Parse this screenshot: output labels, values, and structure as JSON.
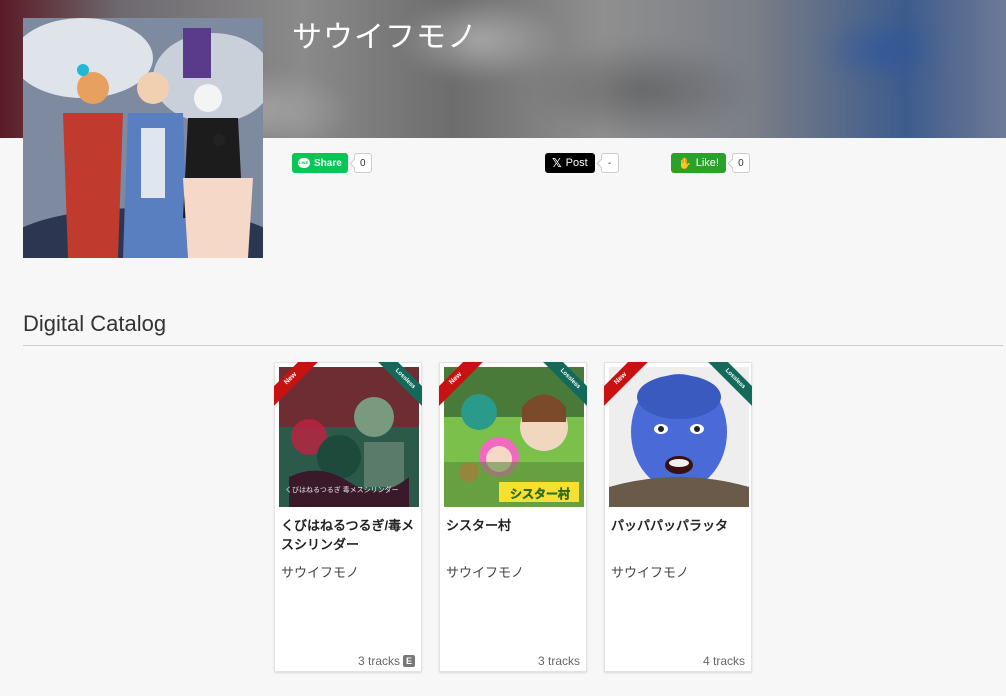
{
  "artist": {
    "name": "サウイフモノ"
  },
  "share": {
    "line_label": "Share",
    "line_count": "0",
    "x_label": "Post",
    "x_count": "-",
    "like_label": "Like!",
    "like_count": "0"
  },
  "catalog": {
    "heading": "Digital Catalog",
    "items": [
      {
        "title": "くびはねるつるぎ/毒メスシリンダー",
        "artist": "サウイフモノ",
        "tracks": "3 tracks",
        "badge_new": "New",
        "badge_lossless": "Lossless",
        "explicit": "E",
        "jacket_text": "くびはねるつるぎ 毒メスシリンダー"
      },
      {
        "title": "シスター村",
        "artist": "サウイフモノ",
        "tracks": "3 tracks",
        "badge_new": "New",
        "badge_lossless": "Lossless",
        "jacket_text": "シスター村"
      },
      {
        "title": "パッパパッパラッタ",
        "artist": "サウイフモノ",
        "tracks": "4 tracks",
        "badge_new": "New",
        "badge_lossless": "Lossless"
      }
    ]
  },
  "colors": {
    "line": "#06c755",
    "x": "#000000",
    "like": "#2aa22a",
    "ribbon_new": "#c81212",
    "ribbon_lossless": "#146a5a"
  }
}
